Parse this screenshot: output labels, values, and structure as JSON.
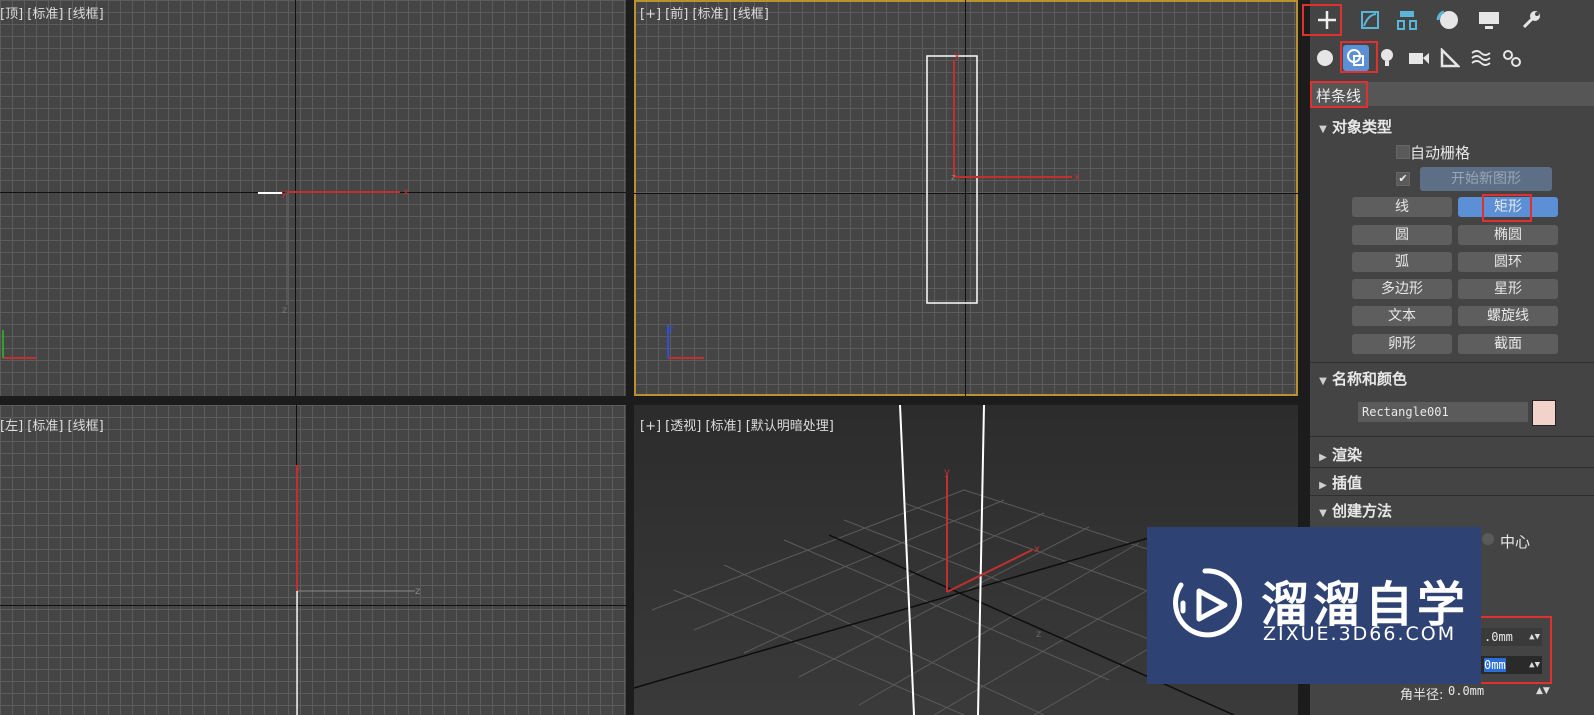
{
  "viewports": {
    "top": {
      "label": "[顶] [标准] [线框]"
    },
    "front": {
      "label": "[+] [前] [标准] [线框]"
    },
    "left": {
      "label": "[左] [标准] [线框]"
    },
    "perspective": {
      "label": "[+] [透视] [标准] [默认明暗处理]"
    }
  },
  "panel": {
    "category": "样条线",
    "object_type": {
      "title": "对象类型",
      "auto_grid": "自动栅格",
      "start_new_shape": "开始新图形",
      "buttons": [
        "线",
        "矩形",
        "圆",
        "椭圆",
        "弧",
        "圆环",
        "多边形",
        "星形",
        "文本",
        "螺旋线",
        "卵形",
        "截面"
      ],
      "active": "矩形"
    },
    "name_color": {
      "title": "名称和颜色",
      "name_value": "Rectangle001",
      "color": "#f4d2cc"
    },
    "rollouts": {
      "render": "渲染",
      "interp": "插值",
      "create_method": "创建方法"
    },
    "create_option": "中心",
    "params": {
      "value1": ".0mm",
      "value2": "0mm",
      "corner_label": "角半径:",
      "corner_value": "0.0mm"
    }
  },
  "watermark": {
    "brand": "溜溜自学",
    "url": "ZIXUE.3D66.COM"
  },
  "colors": {
    "accent": "#5b8fd6",
    "highlight": "#e03030",
    "viewport_border": "#b8922c"
  }
}
